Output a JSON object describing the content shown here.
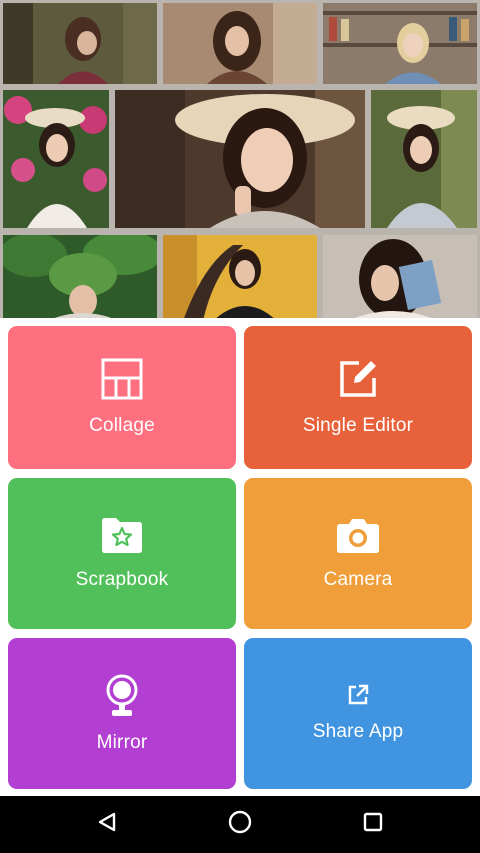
{
  "tiles": [
    {
      "id": "collage",
      "label": "Collage",
      "color": "#fe6f80",
      "icon": "collage-grid-icon"
    },
    {
      "id": "single-editor",
      "label": "Single Editor",
      "color": "#e7613b",
      "icon": "edit-icon"
    },
    {
      "id": "scrapbook",
      "label": "Scrapbook",
      "color": "#52c05a",
      "icon": "folder-star-icon"
    },
    {
      "id": "camera",
      "label": "Camera",
      "color": "#f09e39",
      "icon": "camera-icon"
    },
    {
      "id": "mirror",
      "label": "Mirror",
      "color": "#b33fd2",
      "icon": "mirror-icon"
    },
    {
      "id": "share-app",
      "label": "Share App",
      "color": "#4194e0",
      "icon": "share-icon"
    }
  ],
  "navigation": {
    "back": "back-icon",
    "home": "home-icon",
    "recents": "recents-icon"
  }
}
